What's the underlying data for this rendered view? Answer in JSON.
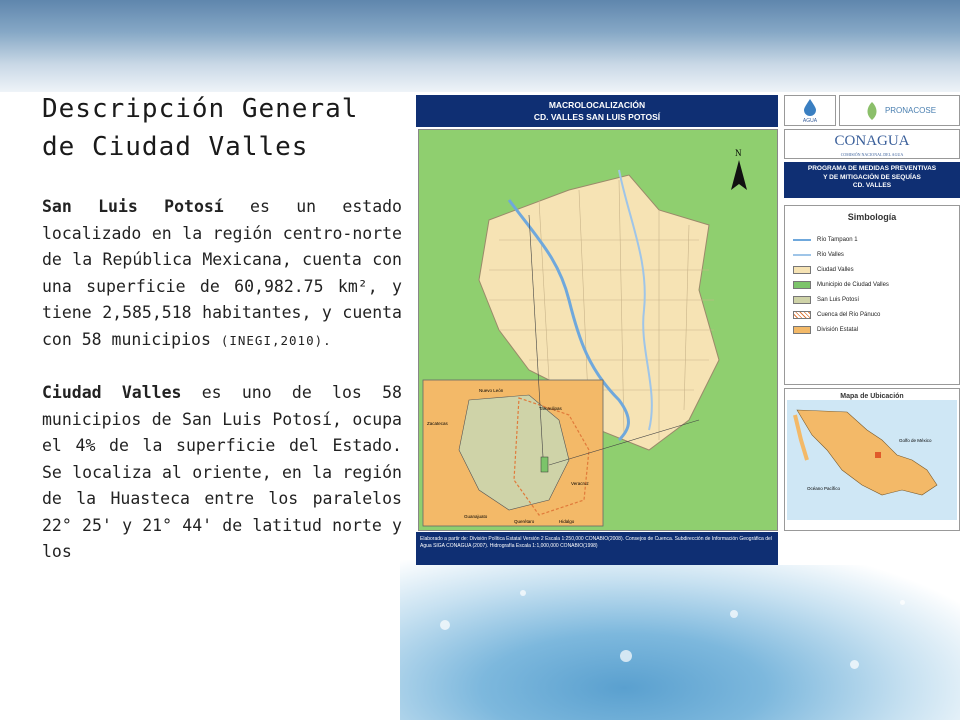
{
  "slide": {
    "title": "Descripción General de Ciudad Valles",
    "para1_bold": "San Luis Potosí",
    "para1_text": " es un estado localizado en la región centro-norte de la República Mexicana, cuenta con una superficie de 60,982.75 km², y tiene 2,585,518 habitantes, y cuenta con 58 municipios ",
    "para1_cite": "(INEGI,2010).",
    "para2_bold": "Ciudad Valles",
    "para2_text": " es uno de los 58 municipios de San Luis Potosí, ocupa el 4% de la superficie del Estado. Se localiza al oriente, en la región de la Huasteca entre los paralelos 22° 25' y 21° 44' de latitud norte y los"
  },
  "map": {
    "header_line1": "MACROLOCALIZACIÓN",
    "header_line2": "CD. VALLES SAN LUIS POTOSÍ",
    "north_label": "N",
    "footer": "Elaborado a partir de: División Política Estatal Versión 2 Escala 1:250,000 CONABIO(2008). Consejos de Cuenca. Subdirección de Información Geográfica del Agua SIGA CONAGUA (2007). Hidrografía Escala 1:1,000,000 CONABIO(1998)",
    "inset_labels": [
      "Nuevo León",
      "Zacatecas",
      "Tamaulipas",
      "Guanajuato",
      "Querétaro",
      "Hidalgo",
      "Veracruz"
    ]
  },
  "logos": {
    "agua_label": "AGUA",
    "pronacose": "PRONACOSE",
    "conagua": "CONAGUA",
    "conagua_sub": "COMISIÓN NACIONAL DEL AGUA"
  },
  "programa": {
    "line1": "PROGRAMA DE MEDIDAS PREVENTIVAS",
    "line2": "Y DE MITIGACIÓN DE SEQUÍAS",
    "line3": "CD. VALLES"
  },
  "legend": {
    "title": "Simbología",
    "items": [
      {
        "label": "Río Tampaon 1",
        "kind": "line",
        "color": "#6fa8dc"
      },
      {
        "label": "Río Valles",
        "kind": "line",
        "color": "#9fc5e8"
      },
      {
        "label": "Ciudad Valles",
        "kind": "fill",
        "color": "#f6e3b4"
      },
      {
        "label": "Municipio de Ciudad Valles",
        "kind": "fill",
        "color": "#7cc46a"
      },
      {
        "label": "San Luis Potosí",
        "kind": "fill",
        "color": "#cfd3a8"
      },
      {
        "label": "Cuenca del Río Pánuco",
        "kind": "hatch",
        "color": "#e07a3a"
      },
      {
        "label": "División Estatal",
        "kind": "fill",
        "color": "#f3b968"
      }
    ]
  },
  "ubicacion": {
    "title": "Mapa de Ubicación",
    "labels": [
      "Golfo de México",
      "Océano Pacífico"
    ]
  }
}
